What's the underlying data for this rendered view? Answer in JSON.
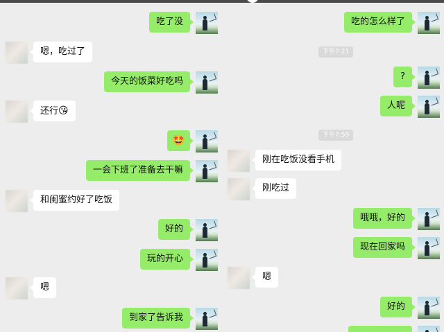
{
  "left": {
    "messages": [
      {
        "side": "out",
        "text": "吃了没"
      },
      {
        "side": "in",
        "text": "嗯，吃过了"
      },
      {
        "side": "out",
        "text": "今天的饭菜好吃吗"
      },
      {
        "side": "in",
        "text": "还行",
        "emoji": "😘"
      },
      {
        "side": "out",
        "text": "",
        "emoji": "🤩"
      },
      {
        "side": "out",
        "text": "一会下班了准备去干嘛"
      },
      {
        "side": "in",
        "text": "和闺蜜约好了吃饭"
      },
      {
        "side": "out",
        "text": "好的"
      },
      {
        "side": "out",
        "text": "玩的开心"
      },
      {
        "side": "in",
        "text": "嗯"
      },
      {
        "side": "out",
        "text": "到家了告诉我"
      }
    ]
  },
  "right": {
    "timestamps": [
      "下午7:21",
      "下午7:59"
    ],
    "messages": [
      {
        "side": "out",
        "text": "吃的怎么样了"
      },
      {
        "side": "out",
        "text": "?"
      },
      {
        "side": "out",
        "text": "人呢"
      },
      {
        "side": "in",
        "text": "刚在吃饭没看手机"
      },
      {
        "side": "in",
        "text": "刚吃过"
      },
      {
        "side": "out",
        "text": "哦哦，好的"
      },
      {
        "side": "out",
        "text": "现在回家吗"
      },
      {
        "side": "in",
        "text": "嗯"
      },
      {
        "side": "out",
        "text": "好的"
      }
    ]
  },
  "colors": {
    "outgoing_bubble": "#95ec69",
    "incoming_bubble": "#ffffff",
    "background": "#ededed"
  },
  "icons": {
    "my_avatar": "person-silhouette-avatar",
    "friend_avatar": "blurred-avatar"
  }
}
